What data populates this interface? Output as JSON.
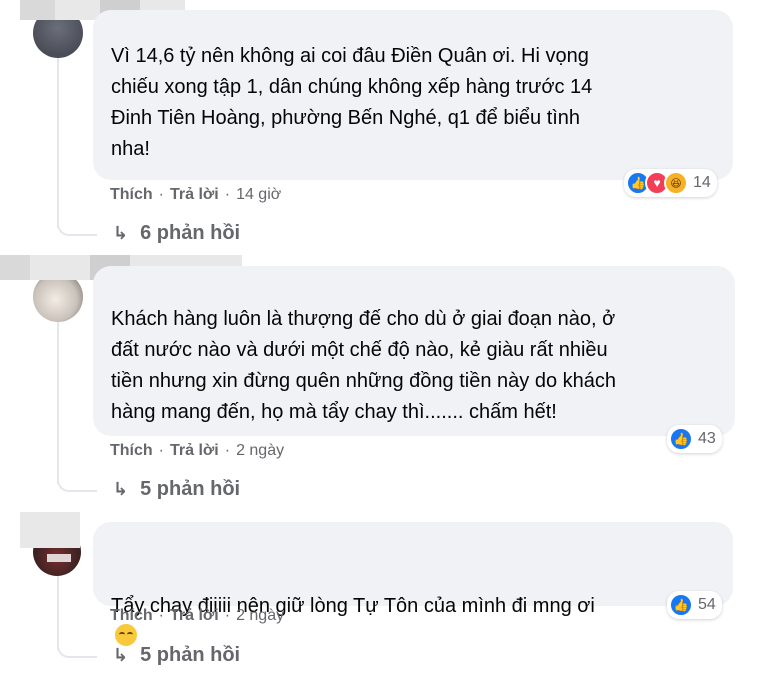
{
  "comments": [
    {
      "text": "Vì 14,6 tỷ nên không ai coi đâu Điền Quân ơi. Hi vọng\nchiếu xong tập 1, dân chúng không xếp hàng trước 14\nĐinh Tiên Hoàng, phường Bến Nghé, q1 để biểu tình\nnha!",
      "like": "Thích",
      "reply": "Trả lời",
      "time": "14 giờ",
      "reaction_count": "14",
      "replies": "6 phản hồi",
      "reaction_types": [
        "like-icon",
        "love-icon",
        "haha-icon"
      ]
    },
    {
      "text": "Khách hàng luôn là thượng đế cho dù ở giai đoạn nào, ở\nđất nước nào và dưới một chế độ nào, kẻ giàu rất nhiều\ntiền nhưng xin đừng quên những đồng tiền này do khách\nhàng mang đến, họ mà tẩy chay thì....... chấm hết!",
      "like": "Thích",
      "reply": "Trả lời",
      "time": "2 ngày",
      "reaction_count": "43",
      "replies": "5 phản hồi",
      "reaction_types": [
        "like-icon"
      ]
    },
    {
      "text": "Tẩy chay điiiii nên giữ lòng Tự Tôn của mình đi mng ơi",
      "like": "Thích",
      "reply": "Trả lời",
      "time": "2 ngày",
      "reaction_count": "54",
      "replies": "5 phản hồi",
      "reaction_types": [
        "like-icon"
      ],
      "trailing_emoji": "relieved-face-emoji"
    }
  ],
  "colors": {
    "bubble": "#f0f2f5",
    "meta_text": "#65676b",
    "like_blue": "#1877f2",
    "love_red": "#f33e58",
    "haha_yellow": "#f7b125"
  },
  "icons": {
    "reply_arrow": "↳"
  }
}
